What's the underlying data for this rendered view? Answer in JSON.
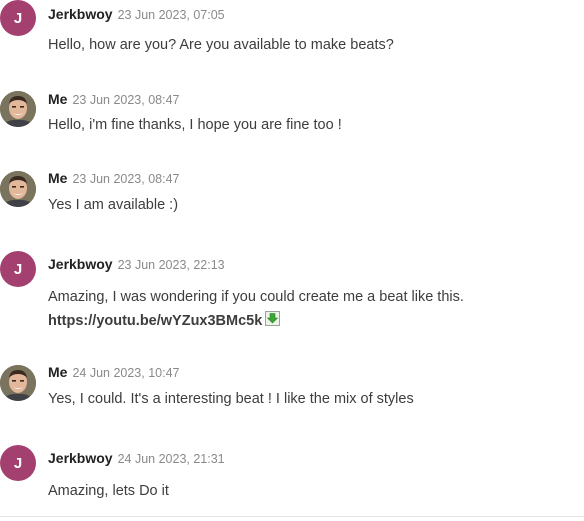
{
  "messages": [
    {
      "author": "Jerkbwoy",
      "avatar_letter": "J",
      "time": "23 Jun 2023, 07:05",
      "text": "Hello, how are you? Are you available to make beats?"
    },
    {
      "author": "Me",
      "time": "23 Jun 2023, 08:47",
      "text": "Hello, i'm fine thanks, I hope you are fine too !"
    },
    {
      "author": "Me",
      "time": "23 Jun 2023, 08:47",
      "text": "Yes I am available :)"
    },
    {
      "author": "Jerkbwoy",
      "avatar_letter": "J",
      "time": "23 Jun 2023, 22:13",
      "text": "Amazing, I was wondering if you could create me a beat like this.",
      "link": "https://youtu.be/wYZux3BMc5k"
    },
    {
      "author": "Me",
      "time": "24 Jun 2023, 10:47",
      "text": "Yes, I could. It's a interesting beat ! I like the mix of styles"
    },
    {
      "author": "Jerkbwoy",
      "avatar_letter": "J",
      "time": "24 Jun 2023, 21:31",
      "text": "Amazing, lets Do it"
    }
  ],
  "icons": {
    "download": "download-icon",
    "avatar_photo": "user-photo-avatar"
  },
  "colors": {
    "avatar_letter_bg": "#a3406f",
    "author_text": "#222222",
    "timestamp_text": "#8a8a8a",
    "body_text": "#3d3d3d",
    "download_icon_green": "#3aa635"
  }
}
